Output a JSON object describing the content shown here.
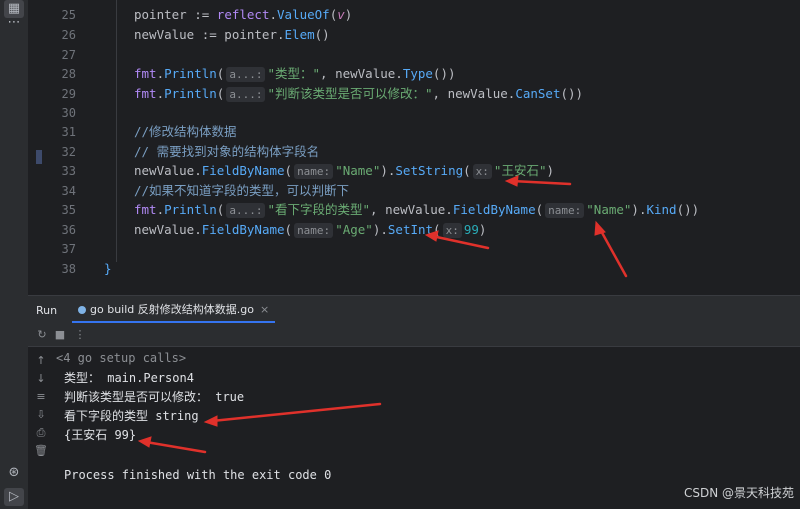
{
  "activity_bar": {
    "icons": [
      "grid-icon",
      "more-icon",
      "debug-icon",
      "run-icon"
    ],
    "more_glyph": "⋯"
  },
  "editor": {
    "line_numbers": [
      "25",
      "26",
      "27",
      "28",
      "29",
      "30",
      "31",
      "32",
      "33",
      "34",
      "35",
      "36",
      "37",
      "38"
    ],
    "lines": {
      "l25": {
        "a": "pointer := ",
        "b": "reflect",
        "c": ".",
        "d": "ValueOf",
        "e": "(",
        "f": "v",
        "g": ")"
      },
      "l26": {
        "a": "newValue := pointer.",
        "b": "Elem",
        "c": "()"
      },
      "l28": {
        "a": "fmt",
        "b": ".",
        "c": "Println",
        "d": "(",
        "hint": "a...:",
        "e": "\"类型：\"",
        "f": ", newValue.",
        "g": "Type",
        "h": "())"
      },
      "l29": {
        "a": "fmt",
        "b": ".",
        "c": "Println",
        "d": "(",
        "hint": "a...:",
        "e": "\"判断该类型是否可以修改：\"",
        "f": ", newValue.",
        "g": "CanSet",
        "h": "())"
      },
      "l31": {
        "comment": "//修改结构体数据"
      },
      "l32": {
        "comment": "// 需要找到对象的结构体字段名"
      },
      "l33": {
        "a": "newValue.",
        "b": "FieldByName",
        "c": "(",
        "hint1": "name:",
        "d": "\"Name\"",
        "e": ").",
        "f": "SetString",
        "g": "(",
        "hint2": "x:",
        "h": "\"王安石\"",
        "i": ")"
      },
      "l34": {
        "comment": "//如果不知道字段的类型，可以判断下"
      },
      "l35": {
        "a": "fmt",
        "b": ".",
        "c": "Println",
        "d": "(",
        "hint1": "a...:",
        "e": "\"看下字段的类型\"",
        "f": ", newValue.",
        "g": "FieldByName",
        "h": "(",
        "hint2": "name:",
        "i": "\"Name\"",
        "j": ").",
        "k": "Kind",
        "l": "())"
      },
      "l36": {
        "a": "newValue.",
        "b": "FieldByName",
        "c": "(",
        "hint1": "name:",
        "d": "\"Age\"",
        "e": ").",
        "f": "SetInt",
        "g": "(",
        "hint2": "x:",
        "h": "99",
        "i": ")"
      },
      "l38": {
        "brace": "}"
      }
    }
  },
  "run_panel": {
    "tab_run": "Run",
    "tab_config": "go build 反射修改结构体数据.go",
    "close_glyph": "×",
    "output": [
      "<4 go setup calls>",
      "类型： main.Person4",
      "判断该类型是否可以修改： true",
      "看下字段的类型 string",
      "{王安石 99}",
      "",
      "Process finished with the exit code 0"
    ]
  },
  "watermark": "CSDN @景天科技苑",
  "colors": {
    "arrow": "#e0312b",
    "accent": "#3574f0"
  }
}
